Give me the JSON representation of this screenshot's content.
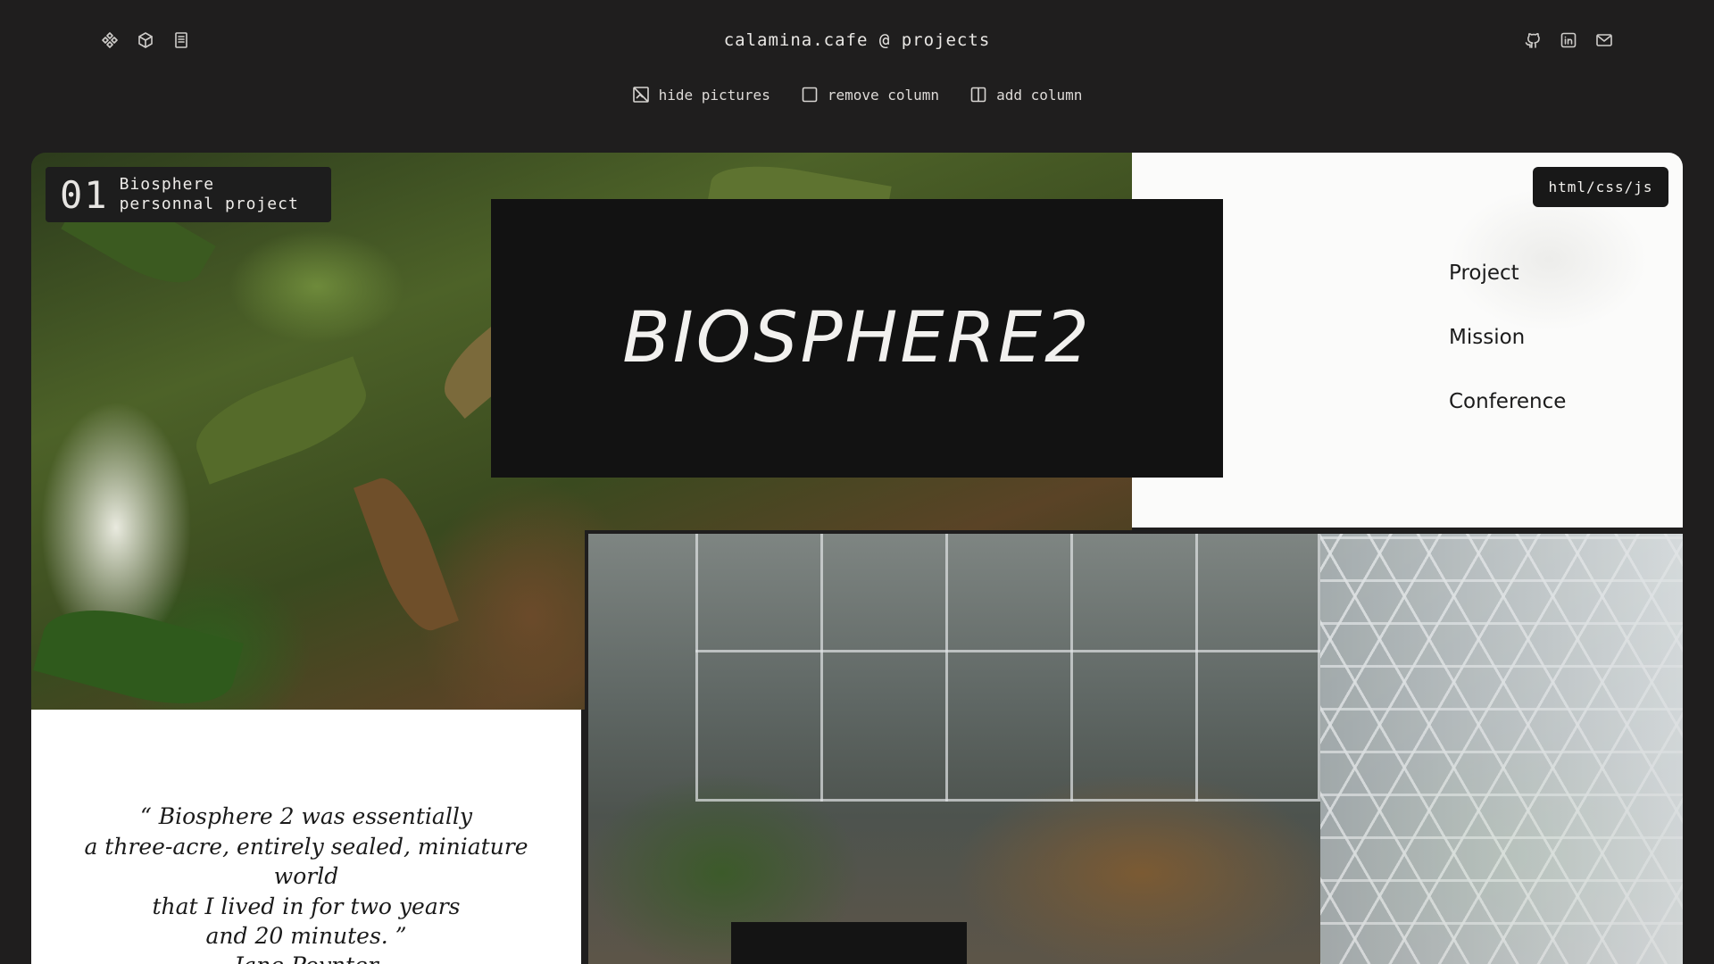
{
  "header": {
    "title": "calamina.cafe @ projects",
    "left_icons": [
      "diamond-grid-icon",
      "cube-icon",
      "document-icon"
    ],
    "right_icons": [
      "github-icon",
      "linkedin-icon",
      "mail-icon"
    ]
  },
  "toolbar": {
    "hide_pictures": "hide pictures",
    "remove_column": "remove column",
    "add_column": "add column"
  },
  "project": {
    "number": "01",
    "name": "Biosphere",
    "type": "personnal project",
    "title": "BIOSPHERE2",
    "tech": "html/css/js"
  },
  "nav": {
    "items": [
      "Project",
      "Mission",
      "Conference"
    ]
  },
  "quote": {
    "lines": [
      "“ Biosphere 2 was essentially",
      "a three-acre, entirely sealed, miniature",
      "world",
      "that I lived in for two years",
      "and 20 minutes. ”"
    ],
    "author": "Jane Poynter"
  },
  "colors": {
    "background": "#1f1e1e",
    "panel_white": "#fbfbfa",
    "title_box": "#121212"
  }
}
